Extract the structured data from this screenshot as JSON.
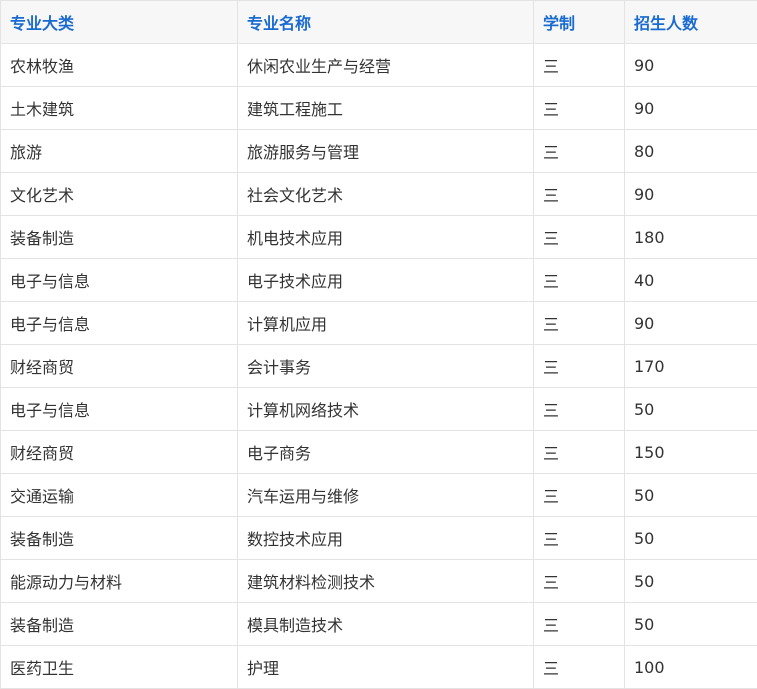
{
  "table": {
    "headers": [
      "专业大类",
      "专业名称",
      "学制",
      "招生人数"
    ],
    "rows": [
      [
        "农林牧渔",
        "休闲农业生产与经营",
        "三",
        "90"
      ],
      [
        "土木建筑",
        "建筑工程施工",
        "三",
        "90"
      ],
      [
        "旅游",
        "旅游服务与管理",
        "三",
        "80"
      ],
      [
        "文化艺术",
        "社会文化艺术",
        "三",
        "90"
      ],
      [
        "装备制造",
        "机电技术应用",
        "三",
        "180"
      ],
      [
        "电子与信息",
        "电子技术应用",
        "三",
        "40"
      ],
      [
        "电子与信息",
        "计算机应用",
        "三",
        "90"
      ],
      [
        "财经商贸",
        "会计事务",
        "三",
        "170"
      ],
      [
        "电子与信息",
        "计算机网络技术",
        "三",
        "50"
      ],
      [
        "财经商贸",
        "电子商务",
        "三",
        "150"
      ],
      [
        "交通运输",
        "汽车运用与维修",
        "三",
        "50"
      ],
      [
        "装备制造",
        "数控技术应用",
        "三",
        "50"
      ],
      [
        "能源动力与材料",
        "建筑材料检测技术",
        "三",
        "50"
      ],
      [
        "装备制造",
        "模具制造技术",
        "三",
        "50"
      ],
      [
        "医药卫生",
        "护理",
        "三",
        "100"
      ]
    ]
  }
}
